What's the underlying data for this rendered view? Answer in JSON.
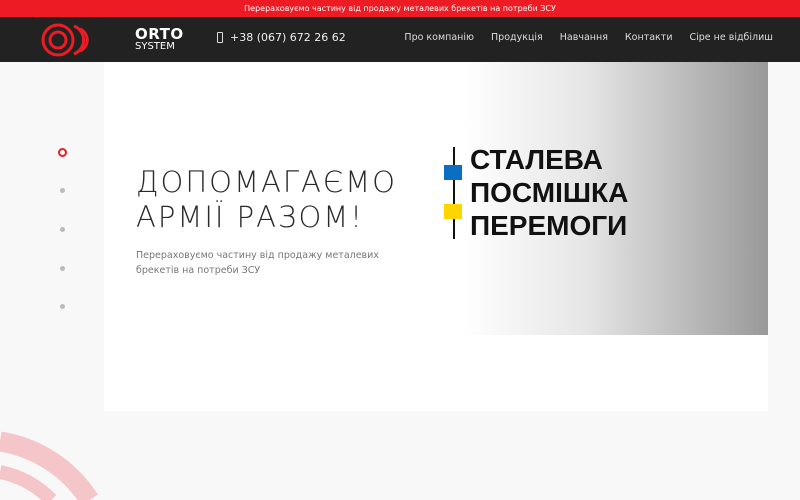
{
  "topbar": {
    "text": "Перераховуємо частину від продажу металевих брекетів на потреби ЗСУ"
  },
  "header": {
    "logo": {
      "line1": "ORTO",
      "line2": "SYSTEM"
    },
    "phone": "+38 (067) 672 26 62",
    "nav": [
      "Про компанію",
      "Продукція",
      "Навчання",
      "Контакти",
      "Сіре не відбілиш"
    ]
  },
  "hero": {
    "title_line1": "ДОПОМАГАЄМО",
    "title_line2": "АРМІЇ РАЗОМ!",
    "subtitle": "Перераховуємо частину від продажу металевих брекетів на потреби ЗСУ",
    "promo": [
      "СТАЛЕВА",
      "ПОСМІШКА",
      "ПЕРЕМОГИ"
    ],
    "slides_count": 5,
    "active_slide": 1
  },
  "colors": {
    "accent": "#ed1c24",
    "header": "#222222",
    "blue": "#0a6fc2",
    "yellow": "#ffd500"
  }
}
